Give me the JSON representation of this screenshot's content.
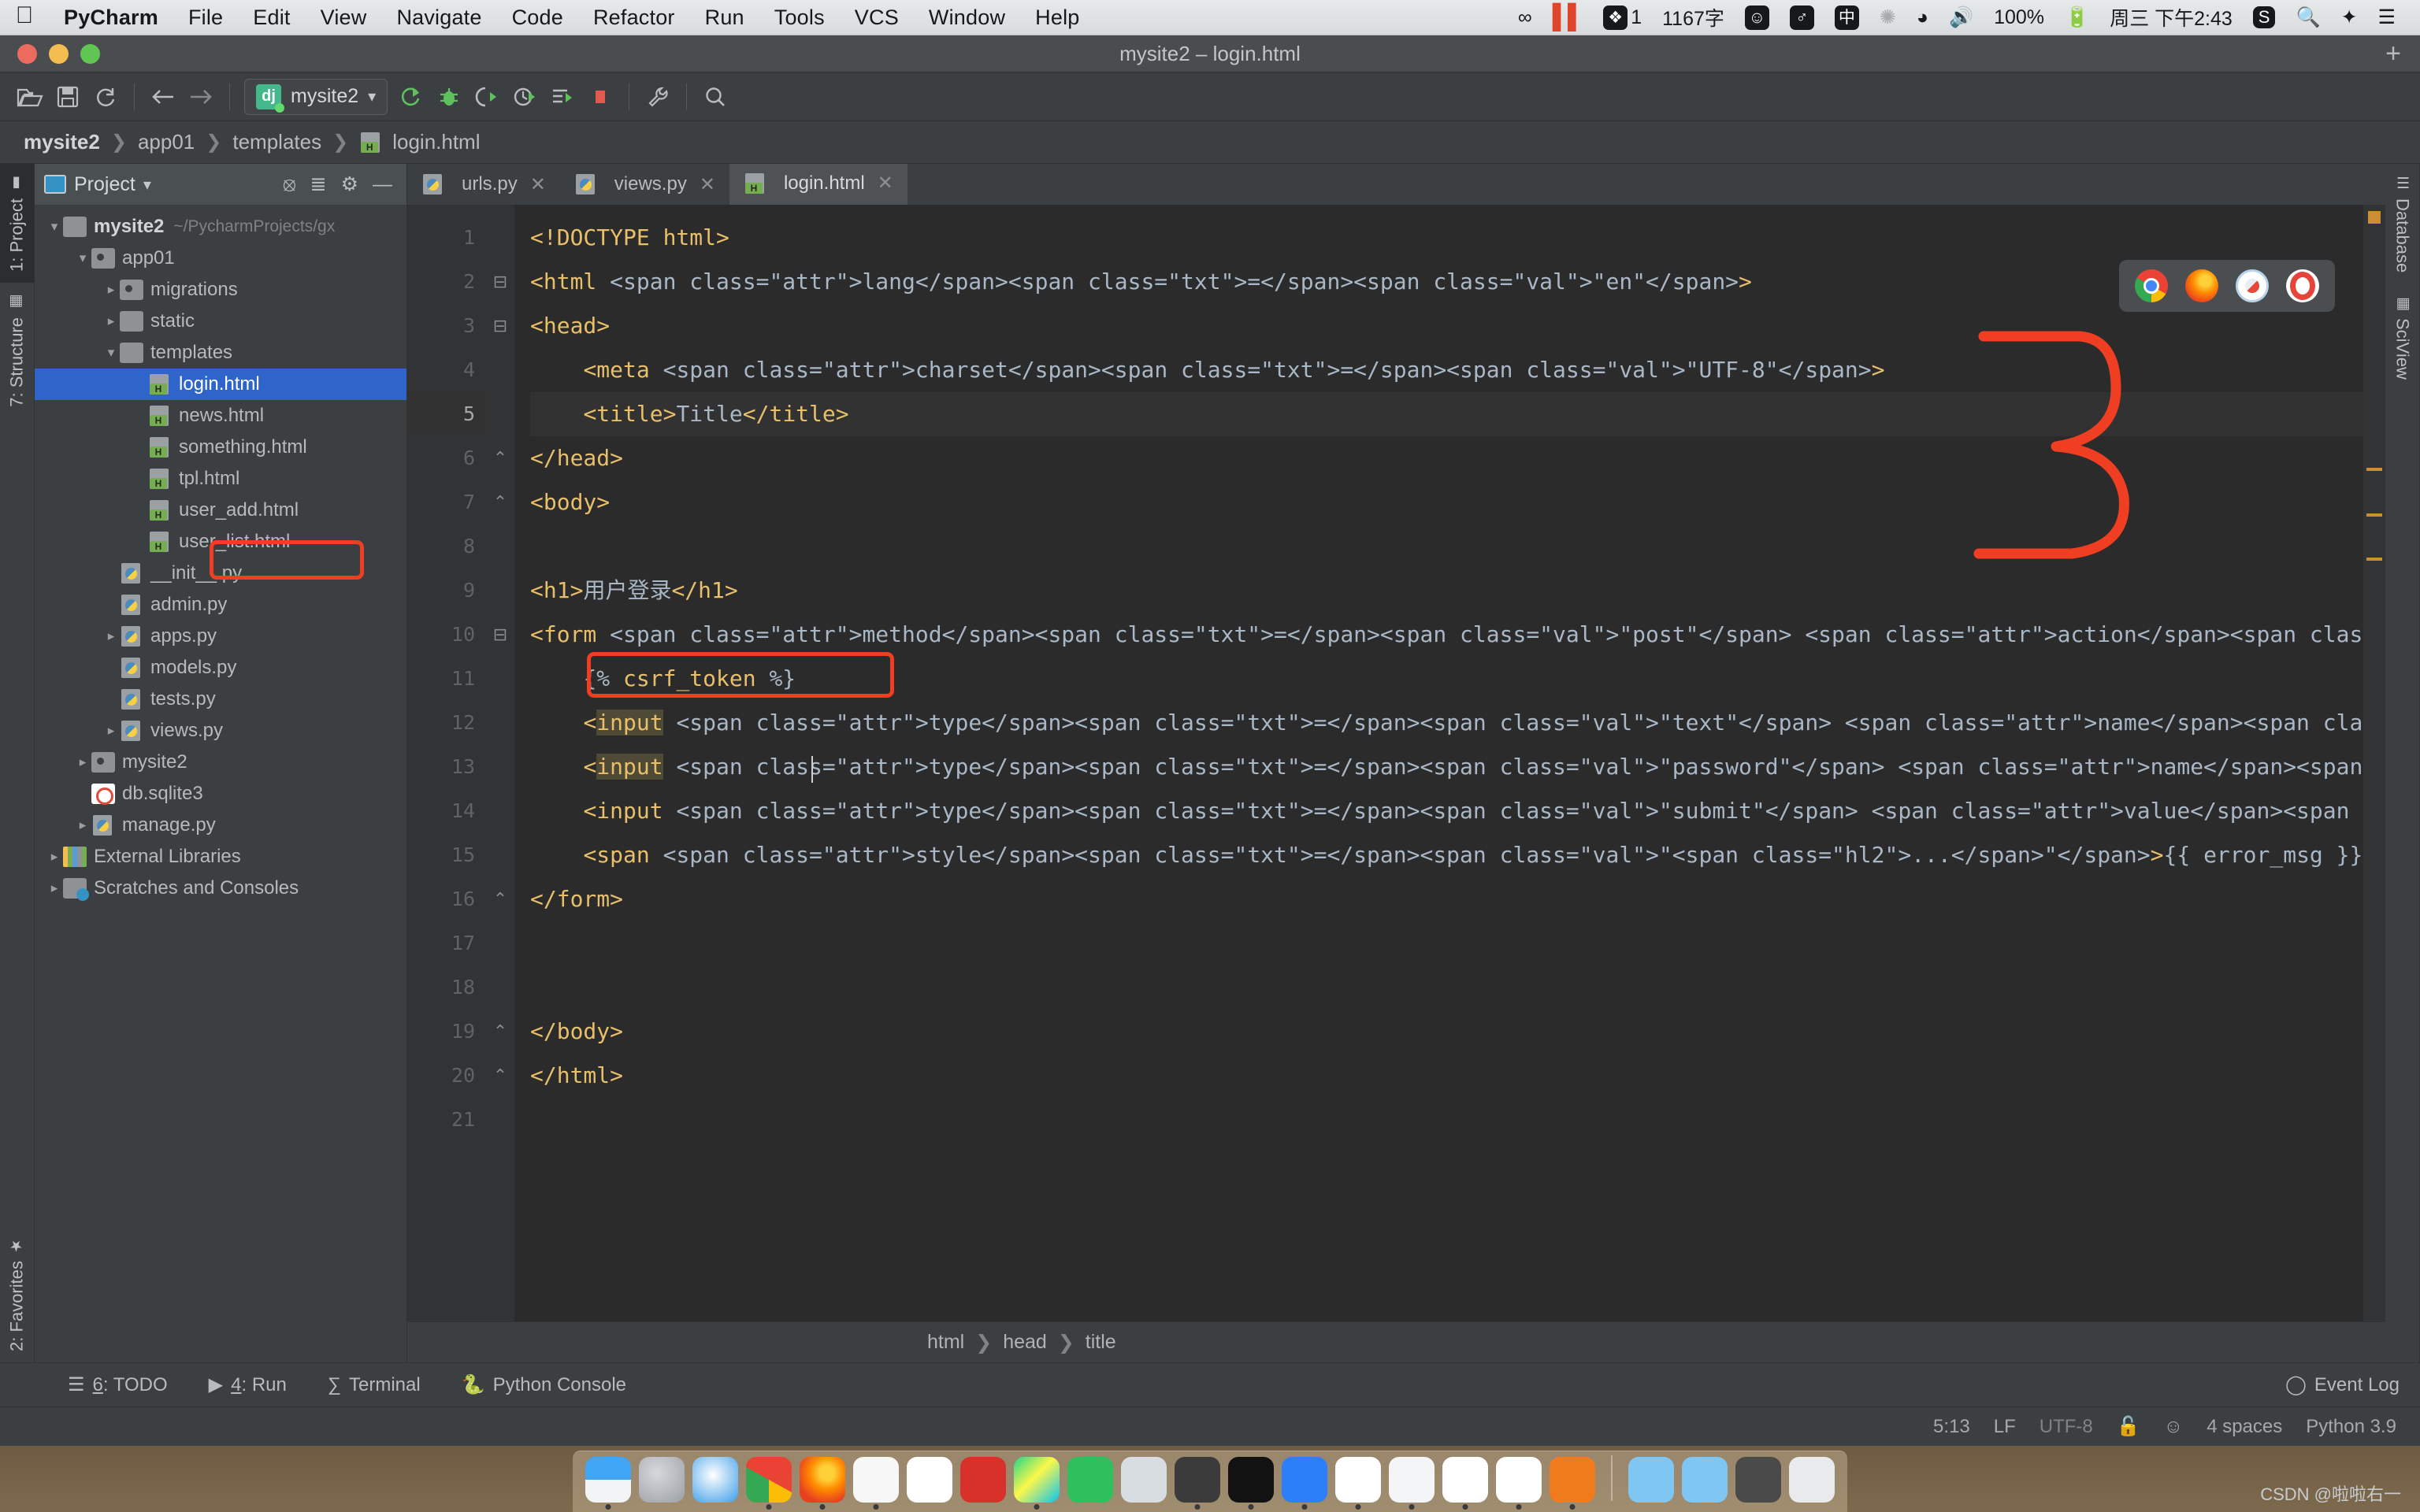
{
  "mac_menubar": {
    "apple_icon": "apple-logo",
    "items": [
      {
        "label": "PyCharm",
        "bold": true
      },
      {
        "label": "File",
        "bold": false
      },
      {
        "label": "Edit",
        "bold": false
      },
      {
        "label": "View",
        "bold": false
      },
      {
        "label": "Navigate",
        "bold": false
      },
      {
        "label": "Code",
        "bold": false
      },
      {
        "label": "Refactor",
        "bold": false
      },
      {
        "label": "Run",
        "bold": false
      },
      {
        "label": "Tools",
        "bold": false
      },
      {
        "label": "VCS",
        "bold": false
      },
      {
        "label": "Window",
        "bold": false
      },
      {
        "label": "Help",
        "bold": false
      }
    ],
    "status_items": {
      "evernote_icon": "infinity-icon",
      "pause_bars": "||",
      "feather_badge": "1",
      "word_count": "1167字",
      "emoji_icon": "smiley-icon",
      "mic_icon": "microphone-icon",
      "ime_icon": "中",
      "bluetooth_icon": "bluetooth-icon",
      "wifi_icon": "wifi-icon",
      "volume_icon": "speaker-icon",
      "battery_percent": "100%",
      "battery_icon": "battery-charging-icon",
      "clock": "周三 下午2:43",
      "sogou_icon": "S",
      "spotlight_icon": "search-icon",
      "siri_icon": "siri-icon",
      "control_center_icon": "list-icon"
    }
  },
  "window": {
    "title": "mysite2 – login.html",
    "add_button": "+"
  },
  "toolbar": {
    "buttons": [
      {
        "name": "open-folder",
        "glyph": "open-folder-icon"
      },
      {
        "name": "save-all",
        "glyph": "save-icon"
      },
      {
        "name": "sync",
        "glyph": "refresh-icon"
      },
      {
        "name": "back",
        "glyph": "arrow-left-icon"
      },
      {
        "name": "forward",
        "glyph": "arrow-right-icon"
      }
    ],
    "run_config": {
      "label": "mysite2",
      "icon": "django-icon",
      "dropdown": "▾"
    },
    "run_buttons": [
      {
        "name": "run",
        "glyph": "run-icon"
      },
      {
        "name": "debug",
        "glyph": "bug-icon"
      },
      {
        "name": "run-coverage",
        "glyph": "coverage-icon"
      },
      {
        "name": "profile",
        "glyph": "profile-icon"
      },
      {
        "name": "attach",
        "glyph": "attach-icon"
      },
      {
        "name": "stop",
        "glyph": "stop-icon"
      }
    ],
    "right_buttons": [
      {
        "name": "settings",
        "glyph": "wrench-icon"
      },
      {
        "name": "search-everywhere",
        "glyph": "search-icon"
      }
    ]
  },
  "breadcrumb": {
    "items": [
      "mysite2",
      "app01",
      "templates",
      "login.html"
    ],
    "separator": "❯"
  },
  "left_tool_strip": {
    "tabs": [
      {
        "label": "1: Project",
        "active": true,
        "icon": "project-icon"
      },
      {
        "label": "7: Structure",
        "active": false,
        "icon": "structure-icon"
      }
    ],
    "bottom_tab": {
      "label": "2: Favorites",
      "icon": "star-icon"
    }
  },
  "right_tool_strip": {
    "tabs": [
      {
        "label": "Database",
        "icon": "database-icon"
      },
      {
        "label": "SciView",
        "icon": "grid-icon"
      }
    ]
  },
  "project_panel": {
    "header": {
      "title": "Project",
      "dropdown": "▾",
      "icons": [
        "locate-icon",
        "collapse-all-icon",
        "gear-icon",
        "minimize-icon"
      ]
    },
    "tree": [
      {
        "label": "mysite2",
        "path": "~/PycharmProjects/gx",
        "depth": 0,
        "arrow": "▾",
        "icon": "folder",
        "bold": true,
        "selected": false
      },
      {
        "label": "app01",
        "path": "",
        "depth": 1,
        "arrow": "▾",
        "icon": "folder-source",
        "bold": false,
        "selected": false
      },
      {
        "label": "migrations",
        "path": "",
        "depth": 2,
        "arrow": "▸",
        "icon": "folder-source",
        "bold": false,
        "selected": false
      },
      {
        "label": "static",
        "path": "",
        "depth": 2,
        "arrow": "▸",
        "icon": "folder",
        "bold": false,
        "selected": false
      },
      {
        "label": "templates",
        "path": "",
        "depth": 2,
        "arrow": "▾",
        "icon": "folder",
        "bold": false,
        "selected": false
      },
      {
        "label": "login.html",
        "path": "",
        "depth": 3,
        "arrow": "",
        "icon": "html",
        "bold": false,
        "selected": true
      },
      {
        "label": "news.html",
        "path": "",
        "depth": 3,
        "arrow": "",
        "icon": "html",
        "bold": false,
        "selected": false
      },
      {
        "label": "something.html",
        "path": "",
        "depth": 3,
        "arrow": "",
        "icon": "html",
        "bold": false,
        "selected": false
      },
      {
        "label": "tpl.html",
        "path": "",
        "depth": 3,
        "arrow": "",
        "icon": "html",
        "bold": false,
        "selected": false
      },
      {
        "label": "user_add.html",
        "path": "",
        "depth": 3,
        "arrow": "",
        "icon": "html",
        "bold": false,
        "selected": false
      },
      {
        "label": "user_list.html",
        "path": "",
        "depth": 3,
        "arrow": "",
        "icon": "html",
        "bold": false,
        "selected": false
      },
      {
        "label": "__init__.py",
        "path": "",
        "depth": 2,
        "arrow": "",
        "icon": "py",
        "bold": false,
        "selected": false
      },
      {
        "label": "admin.py",
        "path": "",
        "depth": 2,
        "arrow": "",
        "icon": "py",
        "bold": false,
        "selected": false
      },
      {
        "label": "apps.py",
        "path": "",
        "depth": 2,
        "arrow": "▸",
        "icon": "py",
        "bold": false,
        "selected": false
      },
      {
        "label": "models.py",
        "path": "",
        "depth": 2,
        "arrow": "",
        "icon": "py",
        "bold": false,
        "selected": false
      },
      {
        "label": "tests.py",
        "path": "",
        "depth": 2,
        "arrow": "",
        "icon": "py",
        "bold": false,
        "selected": false
      },
      {
        "label": "views.py",
        "path": "",
        "depth": 2,
        "arrow": "▸",
        "icon": "py",
        "bold": false,
        "selected": false
      },
      {
        "label": "mysite2",
        "path": "",
        "depth": 1,
        "arrow": "▸",
        "icon": "folder-source",
        "bold": false,
        "selected": false
      },
      {
        "label": "db.sqlite3",
        "path": "",
        "depth": 1,
        "arrow": "",
        "icon": "db",
        "bold": false,
        "selected": false
      },
      {
        "label": "manage.py",
        "path": "",
        "depth": 1,
        "arrow": "▸",
        "icon": "py",
        "bold": false,
        "selected": false
      },
      {
        "label": "External Libraries",
        "path": "",
        "depth": 0,
        "arrow": "▸",
        "icon": "lib",
        "bold": false,
        "selected": false
      },
      {
        "label": "Scratches and Consoles",
        "path": "",
        "depth": 0,
        "arrow": "▸",
        "icon": "scratch",
        "bold": false,
        "selected": false
      }
    ]
  },
  "editor": {
    "tabs": [
      {
        "label": "urls.py",
        "icon": "py",
        "active": false,
        "close": "✕"
      },
      {
        "label": "views.py",
        "icon": "py",
        "active": false,
        "close": "✕"
      },
      {
        "label": "login.html",
        "icon": "html",
        "active": true,
        "close": "✕"
      }
    ],
    "file_name": "login.html",
    "lines": [
      {
        "n": 1,
        "text": "<!DOCTYPE html>"
      },
      {
        "n": 2,
        "text": "<html lang=\"en\">"
      },
      {
        "n": 3,
        "text": "<head>"
      },
      {
        "n": 4,
        "text": "    <meta charset=\"UTF-8\">"
      },
      {
        "n": 5,
        "text": "    <title>Title</title>"
      },
      {
        "n": 6,
        "text": "</head>"
      },
      {
        "n": 7,
        "text": "<body>"
      },
      {
        "n": 8,
        "text": ""
      },
      {
        "n": 9,
        "text": "<h1>用户登录</h1>"
      },
      {
        "n": 10,
        "text": "<form method=\"post\" action=\"/login/\">"
      },
      {
        "n": 11,
        "text": "    {% csrf_token %}"
      },
      {
        "n": 12,
        "text": "    <input type=\"text\" name=\"user\" placeholder=\"用户名\">"
      },
      {
        "n": 13,
        "text": "    <input type=\"password\" name=\"pwd\" placeholder=\"密码\">"
      },
      {
        "n": 14,
        "text": "    <input type=\"submit\" value=\"提交\"/>"
      },
      {
        "n": 15,
        "text": "    <span style=\"...\">{{ error_msg }}</span>"
      },
      {
        "n": 16,
        "text": "</form>"
      },
      {
        "n": 17,
        "text": ""
      },
      {
        "n": 18,
        "text": ""
      },
      {
        "n": 19,
        "text": "</body>"
      },
      {
        "n": 20,
        "text": "</html>"
      },
      {
        "n": 21,
        "text": ""
      }
    ],
    "current_line": 5,
    "breadcrumb": [
      "html",
      "head",
      "title"
    ],
    "breadcrumb_sep": "❯"
  },
  "browser_popup": {
    "browsers": [
      "chrome-icon",
      "firefox-icon",
      "safari-icon",
      "opera-icon"
    ]
  },
  "annotations": {
    "csrf_box_label": "csrf-token-highlight-box",
    "login_file_box_label": "login-html-highlight-box",
    "number_three": "3"
  },
  "tool_windows": {
    "items": [
      {
        "num": "6",
        "label": ": TODO",
        "icon": "todo-icon"
      },
      {
        "num": "4",
        "label": ": Run",
        "icon": "run-icon"
      },
      {
        "num": "",
        "label": "Terminal",
        "icon": "terminal-icon"
      },
      {
        "num": "",
        "label": "Python Console",
        "icon": "python-icon"
      }
    ],
    "event_log": "Event Log",
    "event_log_icon": "balloon-icon"
  },
  "status_bar": {
    "caret_position": "5:13",
    "line_separator": "LF",
    "encoding": "UTF-8",
    "lock_icon": "unlock-icon",
    "inspection_icon": "hector-icon",
    "indent": "4 spaces",
    "interpreter": "Python 3.9"
  },
  "dock": {
    "icons": [
      {
        "name": "finder",
        "color": "linear-gradient(180deg,#41a5f5 0 50%,#f2f4f6 50%)"
      },
      {
        "name": "launchpad",
        "color": "radial-gradient(circle at 40% 35%,#d8d8dc,#9aa0a6)"
      },
      {
        "name": "safari",
        "color": "radial-gradient(circle at 45% 40%,#fff,#3b9de8)"
      },
      {
        "name": "chrome",
        "color": "conic-gradient(#ea4335 0 33%,#fbbc05 33% 50%,#34a853 50% 83%,#ea4335 83%)"
      },
      {
        "name": "firefox",
        "color": "radial-gradient(circle at 60% 35%,#ffd037 0 18%,#ff8a00 42%,#e8401f 75%)"
      },
      {
        "name": "typora",
        "color": "#f7f7f7"
      },
      {
        "name": "calendar",
        "color": "#ffffff"
      },
      {
        "name": "netease-music",
        "color": "#d8312a"
      },
      {
        "name": "pycharm",
        "color": "linear-gradient(135deg,#21d789,#fcf84a 45%,#07c3f2)"
      },
      {
        "name": "wechat",
        "color": "#2ec05c"
      },
      {
        "name": "screenshot-tool",
        "color": "#d8dde2"
      },
      {
        "name": "sublime-text",
        "color": "#3b3b3b"
      },
      {
        "name": "iterm",
        "color": "#121212"
      },
      {
        "name": "evernote",
        "color": "#2d7ff9"
      },
      {
        "name": "excel",
        "color": "#ffffff"
      },
      {
        "name": "parallels",
        "color": "#f3f5f7"
      },
      {
        "name": "wps",
        "color": "#ffffff"
      },
      {
        "name": "sketch",
        "color": "#ffffff"
      },
      {
        "name": "douyin",
        "color": "#f07b1d"
      },
      {
        "name": "downloads",
        "color": "#7fc6f2"
      },
      {
        "name": "documents",
        "color": "#7fc6f2"
      },
      {
        "name": "recent-folder",
        "color": "#4a4a4a"
      },
      {
        "name": "trash",
        "color": "#e8eaec"
      }
    ]
  },
  "watermark": "CSDN @啦啦右一"
}
